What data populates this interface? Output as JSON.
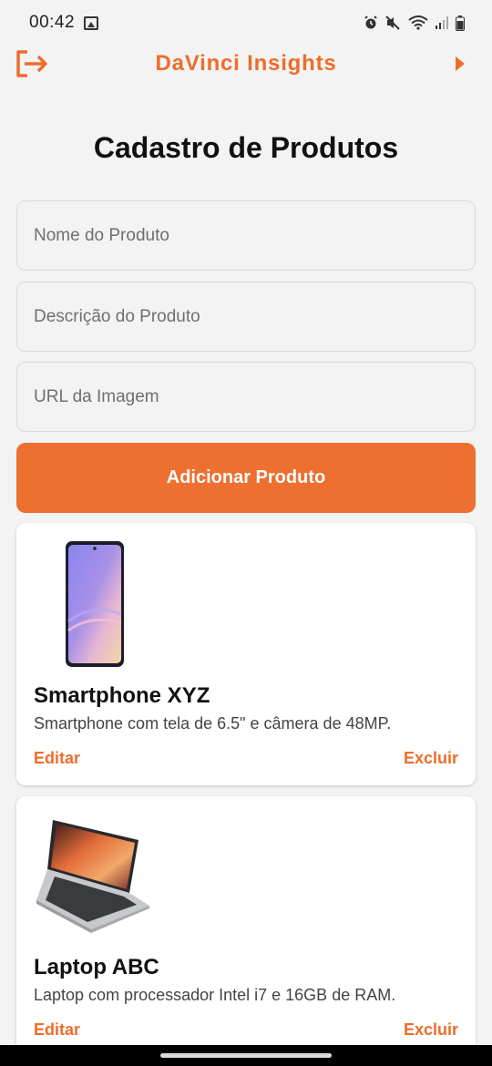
{
  "status_bar": {
    "time": "00:42",
    "icons": [
      "gallery-icon",
      "alarm-icon",
      "mute-icon",
      "wifi-icon",
      "signal-icon",
      "battery-icon"
    ]
  },
  "header": {
    "title": "DaVinci Insights",
    "left_icon": "logout-icon",
    "right_icon": "play-arrow-icon",
    "accent_color": "#ee6d2b"
  },
  "page": {
    "title": "Cadastro de Produtos"
  },
  "form": {
    "name_placeholder": "Nome do Produto",
    "description_placeholder": "Descrição do Produto",
    "image_url_placeholder": "URL da Imagem",
    "submit_label": "Adicionar Produto",
    "button_color": "#ee7030"
  },
  "products": [
    {
      "name": "Smartphone XYZ",
      "description": "Smartphone com tela de 6.5\" e câmera de 48MP.",
      "image": "smartphone-image",
      "edit_label": "Editar",
      "delete_label": "Excluir"
    },
    {
      "name": "Laptop ABC",
      "description": "Laptop com processador Intel i7 e 16GB de RAM.",
      "image": "laptop-image",
      "edit_label": "Editar",
      "delete_label": "Excluir"
    }
  ]
}
